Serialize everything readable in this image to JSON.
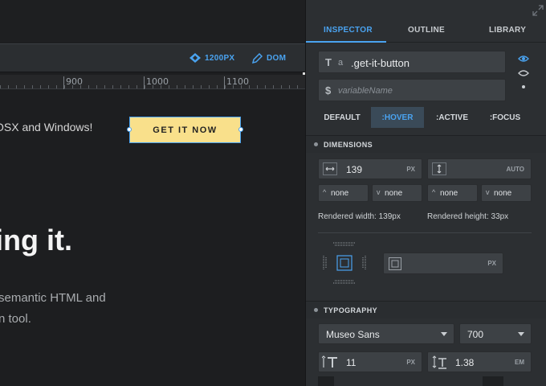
{
  "canvas": {
    "toolbar": {
      "width_label": "1200PX",
      "dom_label": "DOM"
    },
    "ruler_ticks": [
      "900",
      "1000",
      "1100"
    ],
    "text_osx": "OSX and Windows!",
    "cta_label": "GET IT NOW",
    "heading": "ing it.",
    "body_line1": "semantic HTML and",
    "body_line2": "n tool."
  },
  "panel": {
    "tabs": [
      {
        "label": "INSPECTOR",
        "active": true
      },
      {
        "label": "OUTLINE",
        "active": false
      },
      {
        "label": "LIBRARY",
        "active": false
      }
    ],
    "element_prefix": "a",
    "element_class": ".get-it-button",
    "variable_placeholder": "variableName",
    "states": [
      {
        "label": "DEFAULT",
        "active": false
      },
      {
        "label": ":HOVER",
        "active": true
      },
      {
        "label": ":ACTIVE",
        "active": false
      },
      {
        "label": ":FOCUS",
        "active": false
      }
    ],
    "dimensions": {
      "title": "DIMENSIONS",
      "width_value": "139",
      "width_unit": "PX",
      "height_value": "",
      "height_unit": "AUTO",
      "min_width": "none",
      "max_width": "none",
      "min_height": "none",
      "max_height": "none",
      "rendered_width": "Rendered width: 139px",
      "rendered_height": "Rendered height: 33px",
      "box_unit": "PX"
    },
    "typography": {
      "title": "TYPOGRAPHY",
      "font_family": "Museo Sans",
      "font_weight": "700",
      "font_size": "11",
      "font_size_unit": "PX",
      "line_height": "1.38",
      "line_height_unit": "EM"
    }
  },
  "colors": {
    "accent": "#4aa3f0",
    "cta_background": "#f9e08b"
  }
}
